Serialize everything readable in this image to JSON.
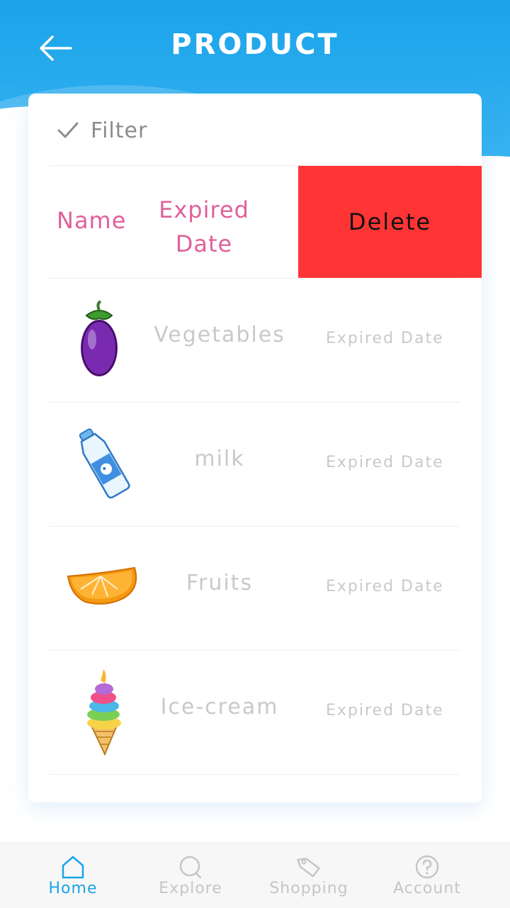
{
  "header": {
    "title": "PRODUCT",
    "back_icon": "arrow-left-icon"
  },
  "filter": {
    "label": "Filter",
    "icon": "check-icon"
  },
  "table": {
    "col_name": "Name",
    "col_expired_line1": "Expired",
    "col_expired_line2": "Date",
    "delete_label": "Delete"
  },
  "items": [
    {
      "name": "Vegetables",
      "expired": "Expired Date",
      "icon": "eggplant-icon"
    },
    {
      "name": "milk",
      "expired": "Expired Date",
      "icon": "milk-bottle-icon"
    },
    {
      "name": "Fruits",
      "expired": "Expired Date",
      "icon": "orange-slice-icon"
    },
    {
      "name": "Ice-cream",
      "expired": "Expired Date",
      "icon": "ice-cream-icon"
    }
  ],
  "nav": [
    {
      "label": "Home",
      "icon": "home-icon",
      "active": true
    },
    {
      "label": "Explore",
      "icon": "search-icon",
      "active": false
    },
    {
      "label": "Shopping",
      "icon": "tag-icon",
      "active": false
    },
    {
      "label": "Account",
      "icon": "help-icon",
      "active": false
    }
  ],
  "colors": {
    "header_blue": "#1aa3ea",
    "accent_pink": "#e0609a",
    "delete_red": "#ff3535",
    "muted_text": "#c9c9c9"
  }
}
